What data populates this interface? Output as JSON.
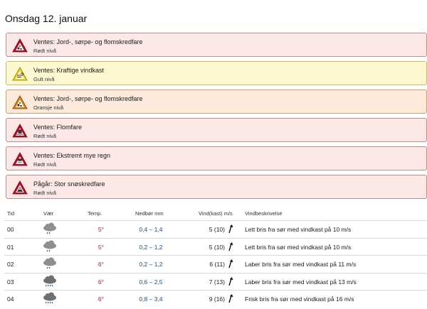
{
  "day_title": "Onsdag 12. januar",
  "warnings": [
    {
      "title": "Ventes: Jord-, sørpe- og flomskredfare",
      "level": "Rødt nivå",
      "color": "red",
      "icon": "landslide-warning-icon"
    },
    {
      "title": "Ventes: Kraftige vindkast",
      "level": "Gult nivå",
      "color": "yellow",
      "icon": "wind-warning-icon"
    },
    {
      "title": "Ventes: Jord-, sørpe- og flomskredfare",
      "level": "Oransje nivå",
      "color": "orange",
      "icon": "landslide-warning-icon"
    },
    {
      "title": "Ventes: Flomfare",
      "level": "Rødt nivå",
      "color": "red",
      "icon": "flood-warning-icon"
    },
    {
      "title": "Ventes: Ekstremt mye regn",
      "level": "Rødt nivå",
      "color": "red",
      "icon": "rain-warning-icon"
    },
    {
      "title": "Pågår: Stor snøskredfare",
      "level": "Rødt nivå",
      "color": "red",
      "icon": "avalanche-warning-icon"
    }
  ],
  "table": {
    "headers": {
      "time": "Tid",
      "weather": "Vær",
      "temp": "Temp.",
      "precip": "Nedbør mm",
      "wind": "Vind(kast) m/s",
      "desc": "Vindbeskrivelse"
    },
    "rows": [
      {
        "time": "00",
        "temp": "5°",
        "precip": "0,4 – 1,4",
        "wind": "5 (10)",
        "desc": "Lett bris fra sør med vindkast på 10 m/s"
      },
      {
        "time": "01",
        "temp": "5°",
        "precip": "0,2 – 1,2",
        "wind": "5 (10)",
        "desc": "Lett bris fra sør med vindkast på 10 m/s"
      },
      {
        "time": "02",
        "temp": "6°",
        "precip": "0,2 – 1,2",
        "wind": "6 (11)",
        "desc": "Laber bris fra sør med vindkast på 11 m/s"
      },
      {
        "time": "03",
        "temp": "6°",
        "precip": "0,6 – 2,5",
        "wind": "7 (13)",
        "desc": "Laber bris fra sør med vindkast på 13 m/s"
      },
      {
        "time": "04",
        "temp": "6°",
        "precip": "0,8 – 3,4",
        "wind": "9 (16)",
        "desc": "Frisk bris fra sør med vindkast på 16 m/s"
      }
    ]
  },
  "colors": {
    "red_bg": "#fde8e8",
    "yellow_bg": "#fdf8cf",
    "orange_bg": "#fdeadb",
    "temp": "#c8102e",
    "precip": "#1a4ea0"
  }
}
